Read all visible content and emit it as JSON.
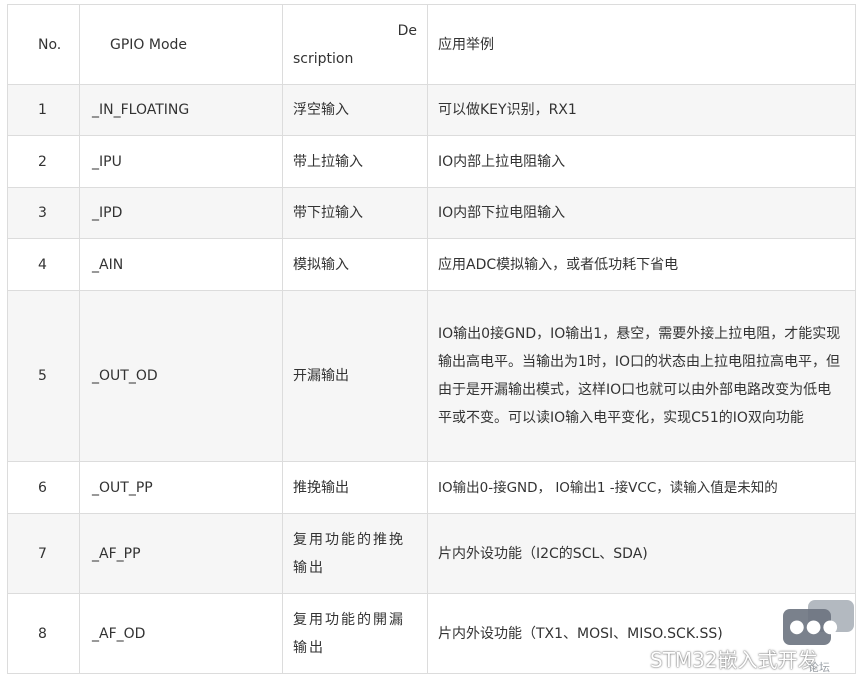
{
  "headers": {
    "no": "No.",
    "mode": "GPIO Mode",
    "desc_a": "De",
    "desc_b": "scription",
    "example": "应用举例"
  },
  "rows": [
    {
      "no": "1",
      "mode": "_IN_FLOATING",
      "desc": "浮空输入",
      "example": "可以做KEY识别，RX1"
    },
    {
      "no": "2",
      "mode": "_IPU",
      "desc": "带上拉输入",
      "example": "IO内部上拉电阻输入"
    },
    {
      "no": "3",
      "mode": "_IPD",
      "desc": "带下拉输入",
      "example": "IO内部下拉电阻输入"
    },
    {
      "no": "4",
      "mode": "_AIN",
      "desc": "模拟输入",
      "example": "应用ADC模拟输入，或者低功耗下省电"
    },
    {
      "no": "5",
      "mode": "_OUT_OD",
      "desc": "开漏输出",
      "example": "IO输出0接GND，IO输出1，悬空，需要外接上拉电阻，才能实现输出高电平。当输出为1时，IO口的状态由上拉电阻拉高电平，但由于是开漏输出模式，这样IO口也就可以由外部电路改变为低电平或不变。可以读IO输入电平变化，实现C51的IO双向功能"
    },
    {
      "no": "6",
      "mode": "_OUT_PP",
      "desc": "推挽输出",
      "example": "IO输出0-接GND， IO输出1 -接VCC，读输入值是未知的"
    },
    {
      "no": "7",
      "mode": "_AF_PP",
      "desc": "复用功能的推挽输出",
      "example": "片内外设功能（I2C的SCL、SDA)"
    },
    {
      "no": "8",
      "mode": "_AF_OD",
      "desc": "复用功能的開漏输出",
      "example": "片内外设功能（TX1、MOSI、MISO.SCK.SS)"
    }
  ],
  "watermark": {
    "text": "STM32嵌入式开发",
    "tag": "论坛"
  }
}
